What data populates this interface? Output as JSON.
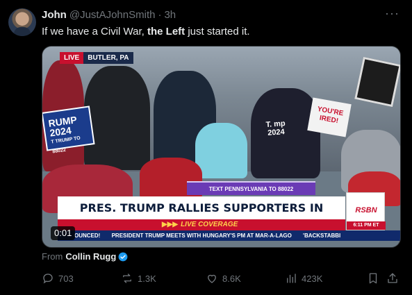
{
  "tweet": {
    "author_name": "John",
    "author_handle": "@JustAJohnSmith",
    "separator": "·",
    "time": "3h",
    "more_icon": "more-horizontal-icon",
    "text_part1": "If we have a Civil War, ",
    "text_bold": "the Left",
    "text_part2": " just started it."
  },
  "video": {
    "live_label": "LIVE",
    "location": "BUTLER, PA",
    "sign_left_line1": "RUMP",
    "sign_left_line2": "2024",
    "sign_left_small": "T TRUMP TO 88022",
    "sign_mid_line1": "YOU'RE",
    "sign_mid_line2": "IRED!",
    "shirt_line1": "T. mp",
    "shirt_line2": "2024",
    "sms_banner": "TEXT PENNSYLVANIA TO 88022",
    "headline": "PRES. TRUMP RALLIES SUPPORTERS IN BUTLER, PA",
    "subheadline": "LIVE COVERAGE",
    "chevrons": "▶▶▶",
    "ticker_items": [
      "OUNCED!",
      "PRESIDENT TRUMP MEETS WITH HUNGARY'S PM AT MAR-A-LAGO",
      "'BACKSTABBI"
    ],
    "network": "RSBN",
    "network_time": "6:11 PM ET",
    "duration": "0:01"
  },
  "attribution": {
    "prefix": "From",
    "name": "Collin Rugg"
  },
  "actions": {
    "replies": "703",
    "reposts": "1.3K",
    "likes": "8.6K",
    "views": "423K"
  },
  "colors": {
    "background": "#000000",
    "text_primary": "#e7e9ea",
    "text_secondary": "#71767b",
    "verified": "#1d9bf0",
    "live_red": "#c8102e",
    "ticker_blue": "#102a6b"
  }
}
